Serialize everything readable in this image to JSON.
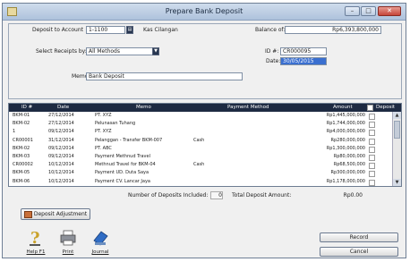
{
  "window": {
    "title": "Prepare Bank Deposit",
    "controls": [
      "–",
      "□",
      "✕"
    ]
  },
  "form": {
    "deposit_to_label": "Deposit to Account",
    "account_number": "1-1100",
    "account_name": "Kas Cilangan",
    "balance_label": "Balance of:",
    "balance_value": "Rp6,393,800,000",
    "select_receipts_label": "Select Receipts by:",
    "select_receipts_value": "All Methods",
    "id_label": "ID #:",
    "id_value": "CR000095",
    "date_label": "Date:",
    "date_value": "30/05/2015",
    "memo_label": "Memo:",
    "memo_value": "Bank Deposit"
  },
  "table": {
    "columns": [
      "ID #",
      "Date",
      "Memo",
      "Payment Method",
      "Amount",
      "Deposit"
    ],
    "rows": [
      {
        "id": "BKM-01",
        "date": "27/12/2014",
        "memo": "PT. XYZ",
        "method": "",
        "amount": "Rp1,445,000,000"
      },
      {
        "id": "BKM-02",
        "date": "27/12/2014",
        "memo": "Pelunasan Tuhang",
        "method": "",
        "amount": "Rp1,744,000,000"
      },
      {
        "id": "1",
        "date": "09/12/2014",
        "memo": "PT. XYZ",
        "method": "",
        "amount": "Rp4,000,000,000"
      },
      {
        "id": "CR00001",
        "date": "31/12/2014",
        "memo": "Pelanggan - Transfer BKM-007",
        "method": "Cash",
        "amount": "Rp280,000,000"
      },
      {
        "id": "BKM-02",
        "date": "09/12/2014",
        "memo": "PT. ABC",
        "method": "",
        "amount": "Rp1,300,000,000"
      },
      {
        "id": "BKM-03",
        "date": "09/12/2014",
        "memo": "Payment Methnud Travel",
        "method": "",
        "amount": "Rp80,000,000"
      },
      {
        "id": "CR00002",
        "date": "10/12/2014",
        "memo": "Methnud Travel for BKM-04",
        "method": "Cash",
        "amount": "Rp68,500,000"
      },
      {
        "id": "BKM-05",
        "date": "10/12/2014",
        "memo": "Payment UD. Duta Saya",
        "method": "",
        "amount": "Rp300,000,000"
      },
      {
        "id": "BKM-06",
        "date": "10/12/2014",
        "memo": "Payment CV. Lancar Jaya",
        "method": "",
        "amount": "Rp1,178,000,000"
      }
    ]
  },
  "summary": {
    "number_label": "Number of Deposits Included:",
    "number_value": "0",
    "total_label": "Total Deposit Amount:",
    "total_value": "Rp0.00"
  },
  "buttons": {
    "deposit_adjustment": "Deposit Adjustment",
    "record": "Record",
    "cancel": "Cancel"
  },
  "toolbar": {
    "help": "Help F1",
    "print": "Print",
    "journal": "Journal"
  }
}
